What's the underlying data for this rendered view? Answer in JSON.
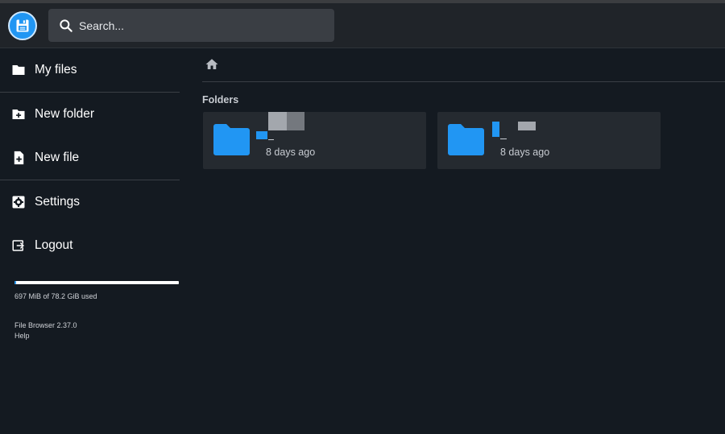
{
  "header": {
    "logo_icon": "floppy-disk-icon",
    "search": {
      "placeholder": "Search...",
      "value": ""
    }
  },
  "sidebar": {
    "items": [
      {
        "label": "My files",
        "icon": "folder-icon"
      },
      {
        "label": "New folder",
        "icon": "folder-plus-icon"
      },
      {
        "label": "New file",
        "icon": "file-plus-icon"
      },
      {
        "label": "Settings",
        "icon": "gear-icon"
      },
      {
        "label": "Logout",
        "icon": "logout-icon"
      }
    ],
    "quota": {
      "text": "697 MiB of 78.2 GiB used",
      "fraction": 0.0087
    },
    "version": "File Browser 2.37.0",
    "help": "Help"
  },
  "main": {
    "breadcrumb_icon": "home-icon",
    "section_title": "Folders",
    "folders": [
      {
        "name": "",
        "modified": "8 days ago"
      },
      {
        "name": "",
        "modified": "8 days ago"
      }
    ]
  },
  "colors": {
    "accent": "#2196f3",
    "background": "#141a21",
    "card": "#252a30",
    "header": "#202429"
  }
}
